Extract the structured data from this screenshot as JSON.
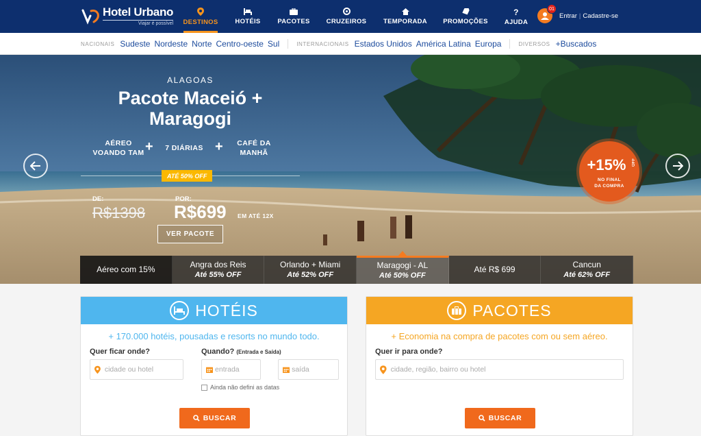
{
  "brand": {
    "name": "Hotel Urbano",
    "tagline": "Viajar é possível"
  },
  "nav": {
    "items": [
      {
        "label": "DESTINOS",
        "icon": "map-pin-icon",
        "active": true
      },
      {
        "label": "HOTÉIS",
        "icon": "bed-icon"
      },
      {
        "label": "PACOTES",
        "icon": "suitcase-icon"
      },
      {
        "label": "CRUZEIROS",
        "icon": "lifebuoy-icon"
      },
      {
        "label": "TEMPORADA",
        "icon": "house-icon"
      },
      {
        "label": "PROMOÇÕES",
        "icon": "tag-icon"
      },
      {
        "label": "AJUDA",
        "icon": "question-icon"
      }
    ],
    "user": {
      "badge": "01",
      "login": "Entrar",
      "signup": "Cadastre-se"
    }
  },
  "subnav": {
    "nacionais_label": "NACIONAIS",
    "nacionais": [
      "Sudeste",
      "Nordeste",
      "Norte",
      "Centro-oeste",
      "Sul"
    ],
    "internacionais_label": "INTERNACIONAIS",
    "internacionais": [
      "Estados Unidos",
      "América Latina",
      "Europa"
    ],
    "diversos_label": "DIVERSOS",
    "diversos": [
      "+Buscados"
    ]
  },
  "hero": {
    "region": "ALAGOAS",
    "title_line1": "Pacote Maceió +",
    "title_line2": "Maragogi",
    "features": [
      {
        "line1": "AÉREO",
        "line2": "VOANDO TAM"
      },
      {
        "line1": "7 DIÁRIAS",
        "line2": ""
      },
      {
        "line1": "CAFÉ DA",
        "line2": "MANHÃ"
      }
    ],
    "discount_tag": "ATÉ 50% OFF",
    "from_label": "DE:",
    "old_price": "R$1398",
    "to_label": "POR:",
    "new_price": "R$699",
    "installments": "EM ATÉ 12X",
    "cta": "VER PACOTE",
    "badge": {
      "value": "+15%",
      "off": "OFF",
      "line1": "NO FINAL",
      "line2": "DA COMPRA"
    }
  },
  "carousel": [
    {
      "name": "Aéreo com 15%",
      "off": ""
    },
    {
      "name": "Angra dos Reis",
      "off": "Até 55% OFF"
    },
    {
      "name": "Orlando + Miami",
      "off": "Até 52% OFF"
    },
    {
      "name": "Maragogi - AL",
      "off": "Até 50% OFF",
      "active": true
    },
    {
      "name": "Até R$ 699",
      "off": ""
    },
    {
      "name": "Cancun",
      "off": "Até 62% OFF"
    }
  ],
  "hotels": {
    "title": "HOTÉIS",
    "subtitle_highlight": "+ 170.000",
    "subtitle_rest": " hotéis, pousadas e resorts no mundo todo.",
    "where_label": "Quer ficar onde?",
    "where_placeholder": "cidade ou hotel",
    "when_label": "Quando?",
    "when_hint": "(Entrada e Saída)",
    "checkin_placeholder": "entrada",
    "checkout_placeholder": "saída",
    "no_dates": "Ainda não defini as datas",
    "button": "BUSCAR",
    "color": "#4fb6ee"
  },
  "packages": {
    "title": "PACOTES",
    "subtitle_highlight": "+ Economia",
    "subtitle_rest": " na compra de pacotes com ou sem aéreo.",
    "where_label": "Quer ir para onde?",
    "where_placeholder": "cidade, região, bairro ou hotel",
    "button": "BUSCAR",
    "color": "#f5a623"
  }
}
